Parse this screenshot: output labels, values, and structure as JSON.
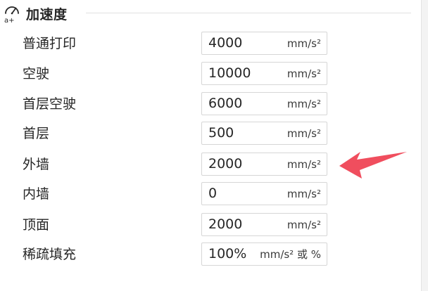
{
  "section": {
    "title": "加速度",
    "icon": "acceleration-icon"
  },
  "rows": [
    {
      "label": "普通打印",
      "value": "4000",
      "unit": "mm/s²"
    },
    {
      "label": "空驶",
      "value": "10000",
      "unit": "mm/s²"
    },
    {
      "label": "首层空驶",
      "value": "6000",
      "unit": "mm/s²"
    },
    {
      "label": "首层",
      "value": "500",
      "unit": "mm/s²"
    },
    {
      "label": "外墙",
      "value": "2000",
      "unit": "mm/s²"
    },
    {
      "label": "内墙",
      "value": "0",
      "unit": "mm/s²"
    },
    {
      "label": "顶面",
      "value": "2000",
      "unit": "mm/s²"
    },
    {
      "label": "稀疏填充",
      "value": "100%",
      "unit": "mm/s² 或 %"
    }
  ],
  "annotation": {
    "arrow_color": "#f04e5e",
    "points_to": "外墙"
  }
}
